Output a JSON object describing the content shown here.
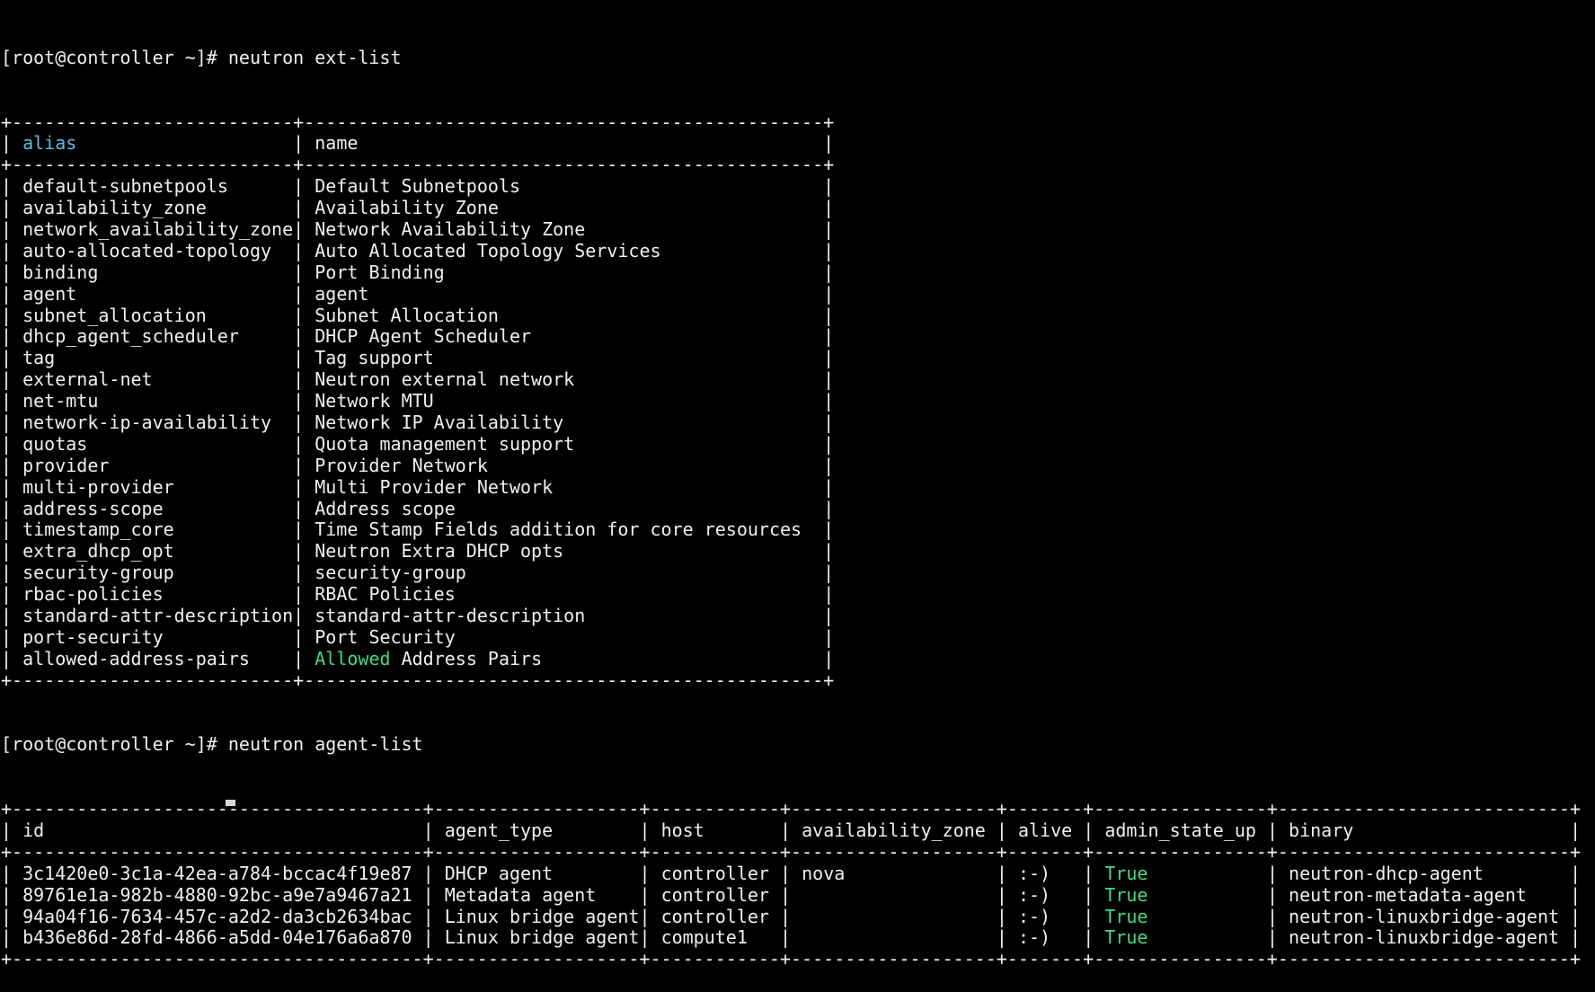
{
  "colors": {
    "background": "#000000",
    "foreground": "#f0f0f0",
    "header_highlight": "#5fb8e8",
    "true_highlight": "#3ddc84"
  },
  "commands": {
    "ext_list": "[root@controller ~]# neutron ext-list",
    "agent_list": "[root@controller ~]# neutron agent-list"
  },
  "ext_table": {
    "columns": [
      "alias",
      "name"
    ],
    "widths": [
      26,
      48
    ],
    "rows": [
      [
        "default-subnetpools",
        "Default Subnetpools"
      ],
      [
        "availability_zone",
        "Availability Zone"
      ],
      [
        "network_availability_zone",
        "Network Availability Zone"
      ],
      [
        "auto-allocated-topology",
        "Auto Allocated Topology Services"
      ],
      [
        "binding",
        "Port Binding"
      ],
      [
        "agent",
        "agent"
      ],
      [
        "subnet_allocation",
        "Subnet Allocation"
      ],
      [
        "dhcp_agent_scheduler",
        "DHCP Agent Scheduler"
      ],
      [
        "tag",
        "Tag support"
      ],
      [
        "external-net",
        "Neutron external network"
      ],
      [
        "net-mtu",
        "Network MTU"
      ],
      [
        "network-ip-availability",
        "Network IP Availability"
      ],
      [
        "quotas",
        "Quota management support"
      ],
      [
        "provider",
        "Provider Network"
      ],
      [
        "multi-provider",
        "Multi Provider Network"
      ],
      [
        "address-scope",
        "Address scope"
      ],
      [
        "timestamp_core",
        "Time Stamp Fields addition for core resources"
      ],
      [
        "extra_dhcp_opt",
        "Neutron Extra DHCP opts"
      ],
      [
        "security-group",
        "security-group"
      ],
      [
        "rbac-policies",
        "RBAC Policies"
      ],
      [
        "standard-attr-description",
        "standard-attr-description"
      ],
      [
        "port-security",
        "Port Security"
      ],
      [
        "allowed-address-pairs",
        "Allowed Address Pairs"
      ]
    ]
  },
  "agent_table": {
    "columns": [
      "id",
      "agent_type",
      "host",
      "availability_zone",
      "alive",
      "admin_state_up",
      "binary"
    ],
    "widths": [
      38,
      19,
      12,
      19,
      7,
      16,
      27
    ],
    "rows": [
      [
        "3c1420e0-3c1a-42ea-a784-bccac4f19e87",
        "DHCP agent",
        "controller",
        "nova",
        ":-)",
        "True",
        "neutron-dhcp-agent"
      ],
      [
        "89761e1a-982b-4880-92bc-a9e7a9467a21",
        "Metadata agent",
        "controller",
        "",
        ":-)",
        "True",
        "neutron-metadata-agent"
      ],
      [
        "94a04f16-7634-457c-a2d2-da3cb2634bac",
        "Linux bridge agent",
        "controller",
        "",
        ":-)",
        "True",
        "neutron-linuxbridge-agent"
      ],
      [
        "b436e86d-28fd-4866-a5dd-04e176a6a870",
        "Linux bridge agent",
        "compute1",
        "",
        ":-)",
        "True",
        "neutron-linuxbridge-agent"
      ]
    ]
  }
}
